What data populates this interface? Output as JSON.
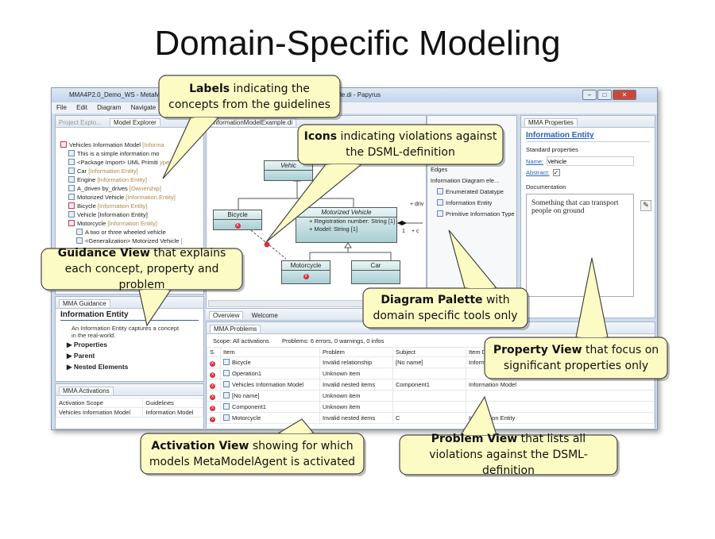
{
  "slide_title": "Domain-Specific Modeling",
  "window": {
    "title_left": "MMA4P2.0_Demo_WS - MetaMode",
    "title_right": "mple.di - Papyrus",
    "controls": [
      "minimize",
      "maximize",
      "close"
    ]
  },
  "menu": [
    "File",
    "Edit",
    "Diagram",
    "Navigate"
  ],
  "explorer": {
    "tabs": [
      "Project Explo...",
      "Model Explorer"
    ],
    "items": [
      {
        "name": "Vehicles Information Model",
        "label": "[Informa",
        "err": true,
        "indent": 0
      },
      {
        "name": "This is a simple information mo",
        "label": "",
        "indent": 1
      },
      {
        "name": "<Package Import> UML Primiti",
        "label": "ypes",
        "indent": 1
      },
      {
        "name": "Car",
        "label": "[Information Entity]",
        "indent": 1
      },
      {
        "name": "Engine",
        "label": "[Information Entity]",
        "indent": 1
      },
      {
        "name": "A_driven by_drives",
        "label": "[Ownership]",
        "indent": 1
      },
      {
        "name": "Motorized Vehicle",
        "label": "[Information Entity]",
        "indent": 1
      },
      {
        "name": "Bicycle",
        "label": "[Information Entity]",
        "err": true,
        "indent": 1
      },
      {
        "name": "Vehicle [Information Entity]",
        "label": "",
        "indent": 1
      },
      {
        "name": "Motorcycle",
        "label": "[Information Entity]",
        "err": true,
        "indent": 1
      },
      {
        "name": "A two or three wheeled vehicle",
        "label": "",
        "indent": 2
      },
      {
        "name": "<Generalization> Motorized Vehicle",
        "label": "[",
        "indent": 2
      }
    ]
  },
  "editor": {
    "tab": "nformationModelExample.di",
    "classes": {
      "vehicle": "Vehic",
      "bicycle": "Bicycle",
      "motorized": "Motorized Vehicle",
      "attr1": "+ Registration number: String [1]",
      "attr2": "+ Model: String [1]",
      "motorcycle": "Motorcycle",
      "car": "Car"
    },
    "assoc": {
      "role1": "+ driv",
      "mult": "1",
      "role2": "+ c"
    }
  },
  "palette": {
    "drawer": "Edges",
    "group": "Information Diagram ele...",
    "tools": [
      "Enumerated Datatype",
      "Information Entity",
      "Primitive Information Type"
    ]
  },
  "properties": {
    "tab": "MMA Properties",
    "heading": "Information Entity",
    "section": "Standard properties",
    "name_label": "Name:",
    "name_value": "Vehicle",
    "abstract_label": "Abstract:",
    "abstract_checked": true,
    "doc_label": "Documentation",
    "doc_value": "Something that can transport people on ground"
  },
  "guidance": {
    "tab": "MMA Guidance",
    "heading": "Information Entity",
    "text": "An Information Entity captures a concept in the real-world.",
    "sections": [
      "Properties",
      "Parent",
      "Nested Elements"
    ]
  },
  "activations": {
    "tab": "MMA Activations",
    "columns": [
      "Activation Scope",
      "Guidelines"
    ],
    "rows": [
      [
        "Vehicles Information Model",
        "Information Model"
      ]
    ]
  },
  "bottom_tabs": [
    "Overview",
    "Welcome"
  ],
  "problems": {
    "tab": "MMA Problems",
    "scope": "Scope: All activations",
    "summary": "Problems: 6 errors, 0 warnings, 0 infos",
    "columns": [
      "S.",
      "Item",
      "Problem",
      "Subject",
      "Item Det"
    ],
    "rows": [
      [
        "Bicycle",
        "Invalid relationship",
        "[No name]",
        "Informa"
      ],
      [
        "Operation1",
        "Unknown item",
        "",
        ""
      ],
      [
        "Vehicles Information Model",
        "Invalid nested items",
        "Component1",
        "Information Model"
      ],
      [
        "[No name]",
        "Unknown item",
        "",
        ""
      ],
      [
        "Component1",
        "Unknown item",
        "",
        ""
      ],
      [
        "Motorcycle",
        "Invalid nested items",
        "C",
        "Information Entity"
      ]
    ]
  },
  "callouts": [
    {
      "bold": "Labels",
      "rest": " indicating the concepts from the guidelines"
    },
    {
      "bold": "Icons",
      "rest": " indicating violations against the DSML-definition"
    },
    {
      "bold": "Guidance View",
      "rest": " that explains each concept, property and problem"
    },
    {
      "bold": "Diagram Palette",
      "rest": " with domain specific tools only"
    },
    {
      "bold": "Property View",
      "rest": " that focus on significant properties only"
    },
    {
      "bold": "Activation View",
      "rest": " showing for which models MetaModelAgent is activated"
    },
    {
      "bold": "Problem View",
      "rest": " that lists all violations against the DSML-definition"
    }
  ],
  "colors": {
    "callout_fill": "#fdfbc4",
    "error": "#d6323e",
    "link": "#2a62b8",
    "label": "#b0864a",
    "class_fill": "#a9cfd3"
  }
}
